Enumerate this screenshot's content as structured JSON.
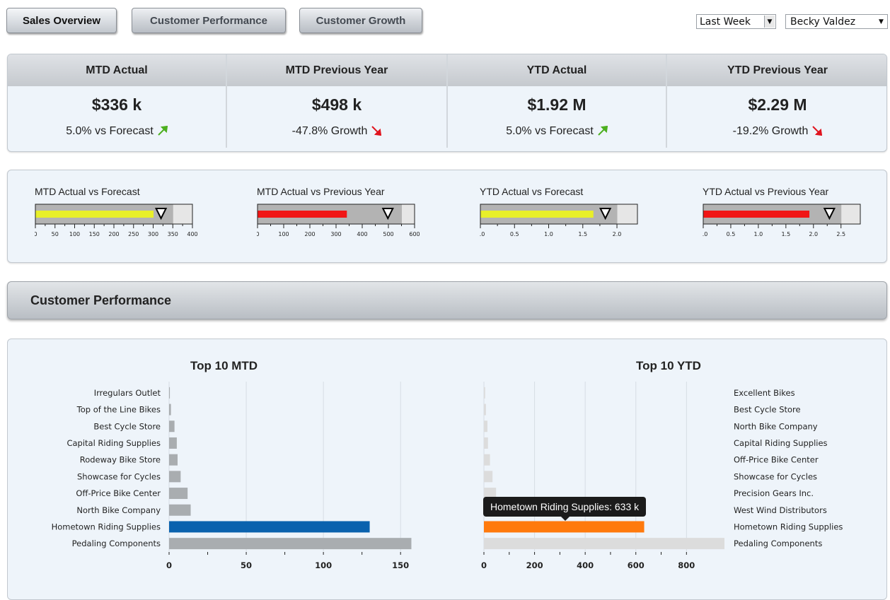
{
  "nav": {
    "tabs": [
      {
        "label": "Sales Overview",
        "active": true
      },
      {
        "label": "Customer Performance",
        "active": false
      },
      {
        "label": "Customer Growth",
        "active": false
      }
    ],
    "period_select": "Last Week",
    "user_select": "Becky Valdez"
  },
  "kpis": [
    {
      "label": "MTD Actual",
      "value": "$336 k",
      "sub": "5.0% vs Forecast",
      "trend": "up"
    },
    {
      "label": "MTD Previous Year",
      "value": "$498 k",
      "sub": "-47.8% Growth",
      "trend": "down"
    },
    {
      "label": "YTD Actual",
      "value": "$1.92 M",
      "sub": "5.0% vs Forecast",
      "trend": "up"
    },
    {
      "label": "YTD Previous Year",
      "value": "$2.29 M",
      "sub": "-19.2% Growth",
      "trend": "down"
    }
  ],
  "colors": {
    "up": "#4caf1f",
    "down": "#e0141e",
    "bullet_yellow": "#e8ef2a",
    "bullet_red": "#f01616",
    "mtd_highlight": "#0a62ae",
    "ytd_highlight": "#ff7a0d",
    "bar_gray": "#a9adb0",
    "bar_light": "#dcdcdc"
  },
  "bullets": [
    {
      "title": "MTD Actual vs Forecast",
      "actual": 300,
      "target": 320,
      "band": 350,
      "max": 400,
      "ticks": [
        "0",
        "50",
        "100",
        "150",
        "200",
        "250",
        "300",
        "350",
        "400"
      ],
      "color": "yellow"
    },
    {
      "title": "MTD Actual vs Previous Year",
      "actual": 340,
      "target": 498,
      "band": 550,
      "max": 600,
      "ticks": [
        "0",
        "100",
        "200",
        "300",
        "400",
        "500",
        "600"
      ],
      "color": "red"
    },
    {
      "title": "YTD Actual vs Forecast",
      "actual": 1.65,
      "target": 1.83,
      "band": 2.0,
      "max": 2.3,
      "ticks": [
        "0.0",
        "0.5",
        "1.0",
        "1.5",
        "2.0"
      ],
      "color": "yellow"
    },
    {
      "title": "YTD Actual vs Previous Year",
      "actual": 1.92,
      "target": 2.29,
      "band": 2.5,
      "max": 2.85,
      "ticks": [
        "0.0",
        "0.5",
        "1.0",
        "1.5",
        "2.0",
        "2.5"
      ],
      "color": "red"
    }
  ],
  "section_title": "Customer Performance",
  "chart_data": [
    {
      "type": "bar",
      "orientation": "horizontal",
      "title": "Top 10 MTD",
      "categories": [
        "Irregulars Outlet",
        "Top of the Line Bikes",
        "Best Cycle Store",
        "Capital Riding Supplies",
        "Rodeway Bike Store",
        "Showcase for Cycles",
        "Off-Price Bike Center",
        "North Bike Company",
        "Hometown Riding Supplies",
        "Pedaling Components"
      ],
      "values": [
        0.5,
        1.2,
        3.5,
        5,
        5.5,
        7.5,
        12,
        14,
        130,
        157
      ],
      "highlight": "Hometown Riding Supplies",
      "xlim": [
        0,
        160
      ],
      "xticks": [
        "0",
        "50",
        "100",
        "150"
      ],
      "grid": true
    },
    {
      "type": "bar",
      "orientation": "horizontal",
      "title": "Top 10 YTD",
      "categories": [
        "Excellent Bikes",
        "Best Cycle Store",
        "North Bike Company",
        "Capital Riding Supplies",
        "Off-Price Bike Center",
        "Showcase for Cycles",
        "Precision Gears Inc.",
        "West Wind Distributors",
        "Hometown Riding Supplies",
        "Pedaling Components"
      ],
      "values": [
        5,
        8,
        14,
        16,
        24,
        34,
        48,
        0,
        633,
        950
      ],
      "highlight": "Hometown Riding Supplies",
      "xlim": [
        0,
        950
      ],
      "xticks": [
        "0",
        "200",
        "400",
        "600",
        "800"
      ],
      "grid": true,
      "tooltip": "Hometown Riding Supplies: 633 k"
    }
  ]
}
